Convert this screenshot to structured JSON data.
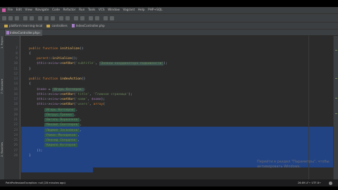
{
  "menu": [
    "File",
    "Edit",
    "View",
    "Navigate",
    "Code",
    "Refactor",
    "Run",
    "Tools",
    "VCS",
    "Window",
    "Vagrant",
    "Help",
    "PHP+SQL"
  ],
  "breadcrumb": [
    {
      "label": "platform learning-local",
      "icon": "folder-icon"
    },
    {
      "label": "controllers",
      "icon": "folder-icon"
    },
    {
      "label": "IndexController.php",
      "icon": "php-file-icon"
    }
  ],
  "tab": {
    "label": "IndexController.php",
    "close": "×"
  },
  "side_labels": {
    "project": "1: Project",
    "structure": "7: Structure",
    "favorites": "2: Favorites"
  },
  "line_numbers": [
    "7",
    "8",
    "9",
    "10",
    "11",
    "12",
    "13",
    "14",
    "15",
    "16",
    "17",
    "18",
    "19",
    "20",
    "21",
    "22",
    "23",
    "24",
    "25",
    "26",
    "27",
    "28"
  ],
  "code": {
    "l7": [
      "    ",
      "public function ",
      "initialize",
      "()"
    ],
    "l8": "    {",
    "l9": [
      "        ",
      "parent",
      "::",
      "initialize",
      "();"
    ],
    "l10": [
      "        ",
      "$this",
      "->",
      "view",
      "->",
      "setVar",
      "(",
      "'subtitle'",
      ", ",
      "'Заявки координатора подвижности'",
      ");"
    ],
    "l11": "    }",
    "l12": "",
    "l13": [
      "    ",
      "public function ",
      "indexAction",
      "()"
    ],
    "l14": "    {",
    "l15": [
      "        ",
      "$name",
      " = ",
      "'Игорь Котляров'",
      ";"
    ],
    "l16": [
      "        ",
      "$this",
      "->",
      "view",
      "->",
      "setVar",
      "(",
      "'title'",
      ", ",
      "'Главная страница'",
      ");"
    ],
    "l17": [
      "        ",
      "$this",
      "->",
      "view",
      "->",
      "setVar",
      "(",
      "'name'",
      ", ",
      "$name",
      ");"
    ],
    "l18": [
      "        ",
      "$this",
      "->",
      "view",
      "->",
      "setVar",
      "(",
      "'users'",
      ", ",
      "array",
      "("
    ],
    "names": [
      "'Игорь Котляров'",
      "'Петрус Тренко'",
      "'Виталь Ворвалков'",
      "'Михаил Светляров'",
      "'Людмил Засвойков'",
      "'Роман Молодиков'",
      "'Леонид Свердлов'",
      "'Кирилл Котляров'"
    ],
    "close_array": "        ));",
    "close_fn": "    }"
  },
  "status": {
    "left": "PathProfessionException: null (28 minutes ago)",
    "right": "26:89 LF÷ UTF-8÷"
  },
  "watermark": [
    "Перейти в раздел \"Параметры\", чтобы",
    "активировать Windows."
  ],
  "colors": {
    "selection": "#214283",
    "keyword": "#cc7832",
    "string": "#6a8759",
    "variable": "#9876aa",
    "function": "#ffc66d"
  }
}
